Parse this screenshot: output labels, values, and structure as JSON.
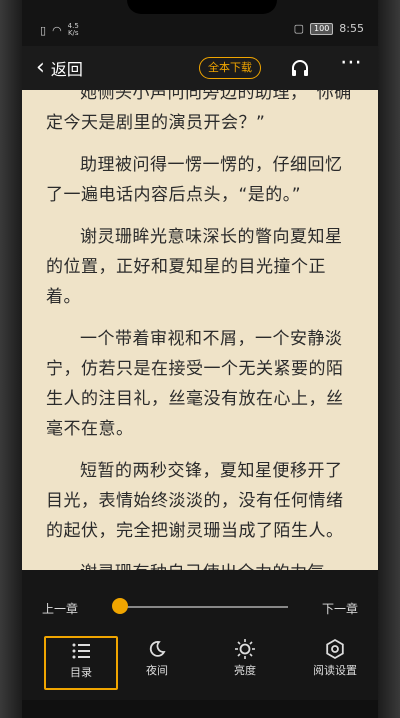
{
  "status": {
    "speed_top": "4.5",
    "speed_bottom": "K/s",
    "battery": "100",
    "time": "8:55"
  },
  "header": {
    "back_label": "返回",
    "download_label": "全本下载"
  },
  "reader": {
    "paragraphs": [
      "她侧头小声问向旁边的助理，“你确定今天是剧里的演员开会？”",
      "助理被问得一愣一愣的，仔细回忆了一遍电话内容后点头，“是的。”",
      "谢灵珊眸光意味深长的瞥向夏知星的位置，正好和夏知星的目光撞个正着。",
      "一个带着审视和不屑，一个安静淡宁，仿若只是在接受一个无关紧要的陌生人的注目礼，丝毫没有放在心上，丝毫不在意。",
      "短暂的两秒交锋，夏知星便移开了目光，表情始终淡淡的，没有任何情绪的起伏，完全把谢灵珊当成了陌生人。",
      "谢灵珊有种自己使出全力的力气"
    ]
  },
  "controls": {
    "prev_chapter": "上一章",
    "next_chapter": "下一章",
    "progress": 0.0,
    "accent": "#f0a500",
    "tabs": [
      {
        "label": "目录",
        "icon": "list-icon",
        "active": true
      },
      {
        "label": "夜间",
        "icon": "moon-icon",
        "active": false
      },
      {
        "label": "亮度",
        "icon": "brightness-icon",
        "active": false
      },
      {
        "label": "阅读设置",
        "icon": "settings-icon",
        "active": false
      }
    ]
  }
}
